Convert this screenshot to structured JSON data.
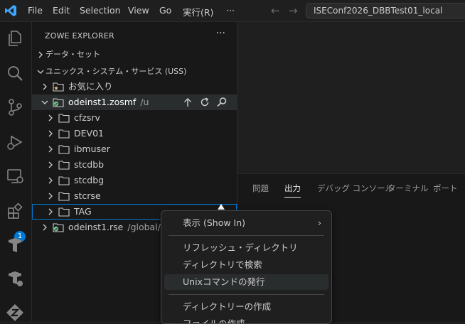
{
  "titlebar": {
    "menus": [
      "File",
      "Edit",
      "Selection",
      "View",
      "Go",
      "実行(R)",
      "···"
    ],
    "command_center": "ISEConf2026_DBBTest01_local"
  },
  "activity": {
    "extensions_badge": "1"
  },
  "sidebar": {
    "title": "ZOWE EXPLORER",
    "more": "···",
    "sections": {
      "dataset": "データ・セット",
      "uss": "ユニックス・システム・サービス (USS)"
    },
    "favorites": "お気に入り",
    "profile1": {
      "name": "odeinst1.zosmf",
      "path": "/u"
    },
    "folders": [
      "cfzsrv",
      "DEV01",
      "ibmuser",
      "stcdbb",
      "stcdbg",
      "stcrse",
      "TAG"
    ],
    "profile2": {
      "name": "odeinst1.rse",
      "path": "/global/zo"
    }
  },
  "panel": {
    "tabs": [
      "問題",
      "出力",
      "デバッグ コンソール",
      "ターミナル",
      "ポート"
    ],
    "active_tab": "出力"
  },
  "context_menu": {
    "items": [
      "表示 (Show In)",
      "リフレッシュ・ディレクトリ",
      "ディレクトリで検索",
      "Unixコマンドの発行",
      "ディレクトリーの作成",
      "ファイルの作成"
    ],
    "submenu_arrow": "›"
  },
  "colors": {
    "accent": "#0078d4",
    "profile_icon": "#73c991",
    "star": "#e2c08d"
  }
}
